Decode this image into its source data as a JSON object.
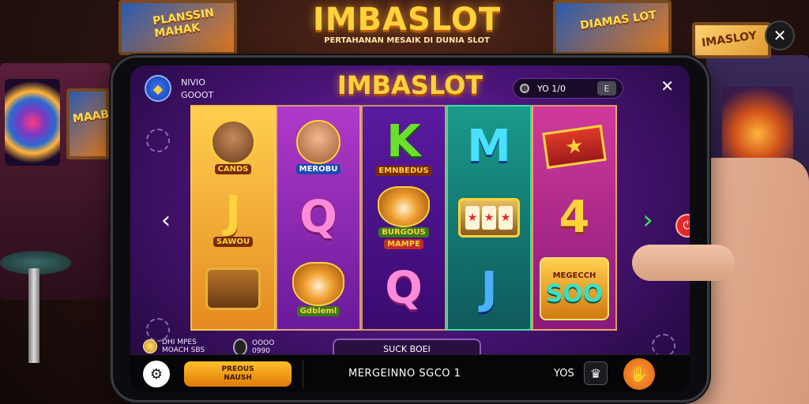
{
  "background": {
    "logo": "IMBASLOT",
    "tagline": "PERTAHANAN MESAIK DI DUNIA SLOT",
    "sign_left": "PLANSSIN MAHAK",
    "sign_right": "DIAMAS LOT",
    "sign_far_right": "IMASLOY",
    "cabinet_left": "MAAB"
  },
  "game": {
    "title": "IMBASLOT",
    "user_line1": "NIVIO",
    "user_line2": "GOOOT",
    "balance": "YO 1/0",
    "menu_label": "E",
    "close_symbol": "✕"
  },
  "reels": [
    {
      "top_caption": "CANDS",
      "mid_letter": "J",
      "mid_caption": "SAWOU"
    },
    {
      "top_caption": "MEROBU",
      "mid_letter": "Q",
      "bot_caption": "Gdbleml"
    },
    {
      "top_letter": "K",
      "top_caption": "EMNBEDUS",
      "mid_caption": "BURGOUS",
      "banner": "MAMPE",
      "bot_letter": "Q"
    },
    {
      "top_letter": "M",
      "bot_letter": "J"
    },
    {
      "mid_letter": "4",
      "bot_caption_top": "MEGECCH",
      "bot_caption": "SOO"
    }
  ],
  "bottom_row": {
    "coin_line1": "DHI MPES",
    "coin_line2": "MOACH SBS",
    "bet_line1": "OOOO",
    "bet_line2": "0990",
    "spin_bar": "SUCK BOEI"
  },
  "footer": {
    "promo_line1": "PREOUS",
    "promo_line2": "NAUSH",
    "status": "MERGEINNO SGCO 1",
    "vos": "YOS"
  },
  "colors": {
    "gold": "#ffd23a",
    "purple": "#8a2ac8",
    "spin_orange": "#e0600a"
  }
}
